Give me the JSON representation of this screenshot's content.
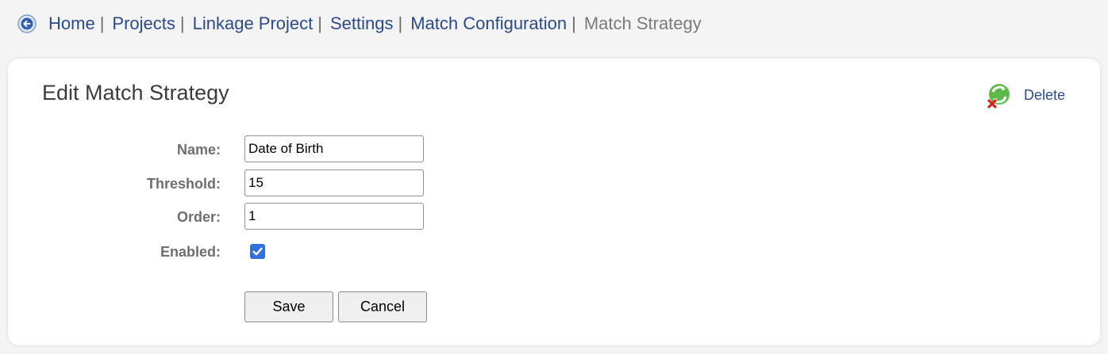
{
  "breadcrumb": {
    "back_icon": "back-arrow-circle-icon",
    "items": [
      {
        "label": "Home"
      },
      {
        "label": "Projects"
      },
      {
        "label": "Linkage Project"
      },
      {
        "label": "Settings"
      },
      {
        "label": "Match Configuration"
      }
    ],
    "separator": "|",
    "current": "Match Strategy"
  },
  "card": {
    "title": "Edit Match Strategy",
    "delete": {
      "icon": "recycle-delete-icon",
      "label": "Delete"
    }
  },
  "form": {
    "name": {
      "label": "Name:",
      "value": "Date of Birth"
    },
    "threshold": {
      "label": "Threshold:",
      "value": "15"
    },
    "order": {
      "label": "Order:",
      "value": "1"
    },
    "enabled": {
      "label": "Enabled:",
      "checked": true
    }
  },
  "buttons": {
    "save": "Save",
    "cancel": "Cancel"
  },
  "colors": {
    "link": "#2b4a8a",
    "checkbox": "#2f6fe0"
  }
}
